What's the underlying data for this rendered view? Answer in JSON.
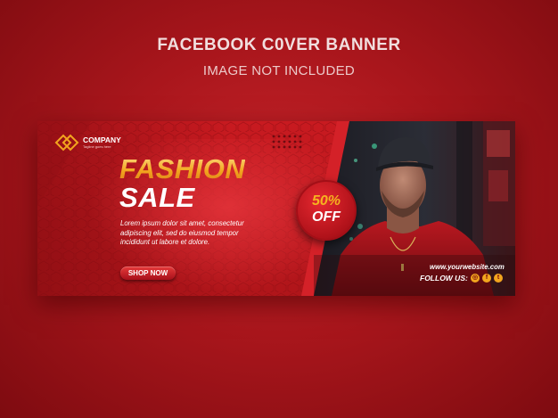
{
  "header": {
    "title": "FACEBOOK C0VER BANNER",
    "subtitle": "IMAGE NOT INCLUDED"
  },
  "banner": {
    "company": {
      "name": "COMPANY",
      "tagline": "Tagline goes here"
    },
    "headline_1": "FASHION",
    "headline_2": "SALE",
    "body": "Lorem ipsum dolor sit amet, consectetur adipiscing elit, sed do eiusmod tempor incididunt ut labore et dolore.",
    "cta_label": "SHOP NOW",
    "discount": {
      "percent": "50%",
      "label": "OFF"
    },
    "website": "www.yourwebsite.com",
    "follow_label": "FOLLOW US:",
    "social_icons": [
      "instagram-icon",
      "facebook-icon",
      "twitter-icon"
    ]
  },
  "colors": {
    "background": "#b0151a",
    "accent_gold": "#f2a51e",
    "white": "#ffffff"
  }
}
